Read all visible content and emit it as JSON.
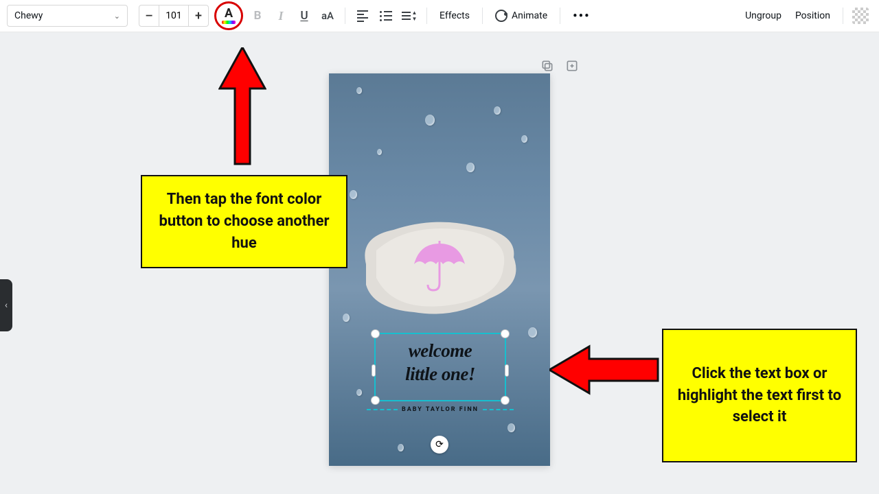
{
  "toolbar": {
    "font_name": "Chewy",
    "font_size": "101",
    "bold_label": "B",
    "italic_label": "I",
    "underline_label": "U",
    "case_label": "aA",
    "effects_label": "Effects",
    "animate_label": "Animate",
    "more_label": "•••",
    "ungroup_label": "Ungroup",
    "position_label": "Position"
  },
  "canvas": {
    "welcome_line1": "welcome",
    "welcome_line2": "little one!",
    "baby_name": "BABY TAYLOR FINN"
  },
  "callouts": {
    "c1": "Then tap the font color button to choose another hue",
    "c2": "Click the text box or highlight the text first to select it"
  }
}
